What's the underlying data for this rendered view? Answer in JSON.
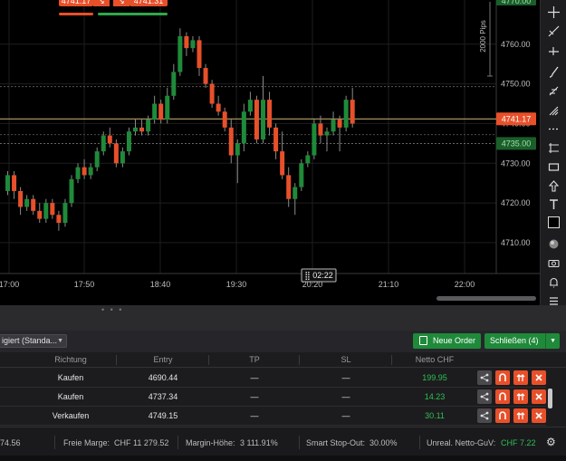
{
  "chart": {
    "time_labels": [
      "17:00",
      "17:50",
      "18:40",
      "19:30",
      "20:20",
      "21:10",
      "22:00"
    ],
    "price_labels": [
      "4760.00",
      "4750.00",
      "4740.00",
      "4730.00",
      "4720.00",
      "4710.00"
    ],
    "current_price_tag": "4741.17",
    "sl_price_tag": "4735.00",
    "top_price_tag": "4770.00",
    "pips_label": "2000 Pips",
    "time_cursor": "02:22",
    "sell_badge": "4741.17",
    "buy_badge": "4741.31",
    "colors": {
      "up": "#1f8a3a",
      "down": "#e8502a",
      "price_line": "#b9a16a",
      "grid": "#1e1e1e"
    }
  },
  "chart_data": {
    "type": "candlestick",
    "ylim": [
      4703,
      4768
    ],
    "x_ticks": [
      "17:00",
      "17:50",
      "18:40",
      "19:30",
      "20:20",
      "21:10",
      "22:00"
    ],
    "candles": [
      {
        "o": 4723,
        "c": 4727,
        "h": 4728,
        "l": 4722
      },
      {
        "o": 4727,
        "c": 4723,
        "h": 4728,
        "l": 4721
      },
      {
        "o": 4723,
        "c": 4719,
        "h": 4724,
        "l": 4717
      },
      {
        "o": 4719,
        "c": 4721,
        "h": 4722,
        "l": 4718
      },
      {
        "o": 4721,
        "c": 4718,
        "h": 4722,
        "l": 4717
      },
      {
        "o": 4718,
        "c": 4716,
        "h": 4720,
        "l": 4715
      },
      {
        "o": 4716,
        "c": 4720,
        "h": 4721,
        "l": 4715
      },
      {
        "o": 4720,
        "c": 4717,
        "h": 4721,
        "l": 4716
      },
      {
        "o": 4717,
        "c": 4715,
        "h": 4718,
        "l": 4713
      },
      {
        "o": 4715,
        "c": 4720,
        "h": 4721,
        "l": 4714
      },
      {
        "o": 4720,
        "c": 4726,
        "h": 4727,
        "l": 4719
      },
      {
        "o": 4726,
        "c": 4729,
        "h": 4730,
        "l": 4725
      },
      {
        "o": 4729,
        "c": 4727,
        "h": 4731,
        "l": 4726
      },
      {
        "o": 4727,
        "c": 4729,
        "h": 4730,
        "l": 4726
      },
      {
        "o": 4729,
        "c": 4733,
        "h": 4734,
        "l": 4728
      },
      {
        "o": 4733,
        "c": 4737,
        "h": 4738,
        "l": 4732
      },
      {
        "o": 4737,
        "c": 4735,
        "h": 4739,
        "l": 4734
      },
      {
        "o": 4735,
        "c": 4730,
        "h": 4736,
        "l": 4729
      },
      {
        "o": 4730,
        "c": 4733,
        "h": 4734,
        "l": 4729
      },
      {
        "o": 4733,
        "c": 4738,
        "h": 4739,
        "l": 4732
      },
      {
        "o": 4738,
        "c": 4739,
        "h": 4741,
        "l": 4737
      },
      {
        "o": 4739,
        "c": 4738,
        "h": 4741,
        "l": 4737
      },
      {
        "o": 4738,
        "c": 4741,
        "h": 4742,
        "l": 4737
      },
      {
        "o": 4741,
        "c": 4745,
        "h": 4747,
        "l": 4740
      },
      {
        "o": 4745,
        "c": 4741,
        "h": 4746,
        "l": 4740
      },
      {
        "o": 4741,
        "c": 4747,
        "h": 4749,
        "l": 4740
      },
      {
        "o": 4747,
        "c": 4753,
        "h": 4755,
        "l": 4746
      },
      {
        "o": 4753,
        "c": 4762,
        "h": 4764,
        "l": 4752
      },
      {
        "o": 4762,
        "c": 4759,
        "h": 4763,
        "l": 4757
      },
      {
        "o": 4759,
        "c": 4761,
        "h": 4762,
        "l": 4758
      },
      {
        "o": 4761,
        "c": 4754,
        "h": 4762,
        "l": 4752
      },
      {
        "o": 4754,
        "c": 4750,
        "h": 4755,
        "l": 4749
      },
      {
        "o": 4750,
        "c": 4745,
        "h": 4751,
        "l": 4744
      },
      {
        "o": 4745,
        "c": 4743,
        "h": 4747,
        "l": 4742
      },
      {
        "o": 4743,
        "c": 4739,
        "h": 4744,
        "l": 4738
      },
      {
        "o": 4739,
        "c": 4732,
        "h": 4741,
        "l": 4730
      },
      {
        "o": 4732,
        "c": 4735,
        "h": 4736,
        "l": 4725
      },
      {
        "o": 4735,
        "c": 4743,
        "h": 4745,
        "l": 4733
      },
      {
        "o": 4743,
        "c": 4746,
        "h": 4748,
        "l": 4742
      },
      {
        "o": 4746,
        "c": 4736,
        "h": 4747,
        "l": 4735
      },
      {
        "o": 4736,
        "c": 4746,
        "h": 4752,
        "l": 4735
      },
      {
        "o": 4746,
        "c": 4739,
        "h": 4748,
        "l": 4737
      },
      {
        "o": 4739,
        "c": 4733,
        "h": 4740,
        "l": 4731
      },
      {
        "o": 4733,
        "c": 4727,
        "h": 4738,
        "l": 4726
      },
      {
        "o": 4727,
        "c": 4721,
        "h": 4729,
        "l": 4719
      },
      {
        "o": 4721,
        "c": 4724,
        "h": 4725,
        "l": 4717
      },
      {
        "o": 4724,
        "c": 4730,
        "h": 4731,
        "l": 4723
      },
      {
        "o": 4730,
        "c": 4732,
        "h": 4733,
        "l": 4729
      },
      {
        "o": 4732,
        "c": 4740,
        "h": 4741,
        "l": 4731
      },
      {
        "o": 4740,
        "c": 4737,
        "h": 4742,
        "l": 4735
      },
      {
        "o": 4737,
        "c": 4738,
        "h": 4739,
        "l": 4733
      },
      {
        "o": 4738,
        "c": 4741,
        "h": 4743,
        "l": 4737
      },
      {
        "o": 4741,
        "c": 4739,
        "h": 4742,
        "l": 4733
      },
      {
        "o": 4739,
        "c": 4746,
        "h": 4747,
        "l": 4738
      },
      {
        "o": 4746,
        "c": 4740,
        "h": 4749,
        "l": 4739
      }
    ],
    "reference_lines": [
      4741.17,
      4735.0,
      4749.3,
      4737.2
    ]
  },
  "toolbar": {
    "icons": [
      "crosshair-icon",
      "trendline-icon",
      "horizontal-line-icon",
      "brush-icon",
      "fibonacci-icon",
      "pitchfork-icon",
      "dashed-line-icon",
      "channel-icon",
      "rectangle-icon",
      "arrow-icon",
      "text-icon",
      "color-swatch-icon",
      "sphere-icon",
      "camera-icon",
      "bell-icon",
      "list-icon"
    ]
  },
  "orders_bar": {
    "strategy_label": "igiert (Standa...",
    "new_order_label": "Neue Order",
    "close_label": "Schließen (4)"
  },
  "positions": {
    "headers": [
      "Richtung",
      "Entry",
      "TP",
      "SL",
      "Netto CHF"
    ],
    "rows": [
      {
        "direction": "Kaufen",
        "entry": "4690.44",
        "tp": "—",
        "sl": "—",
        "net": "199.95"
      },
      {
        "direction": "Kaufen",
        "entry": "4737.34",
        "tp": "—",
        "sl": "—",
        "net": "14.23"
      },
      {
        "direction": "Verkaufen",
        "entry": "4749.15",
        "tp": "—",
        "sl": "—",
        "net": "30.11"
      }
    ]
  },
  "status": {
    "balance_partial": "74.56",
    "free_margin_label": "Freie Marge:",
    "free_margin_value": "CHF 11 279.52",
    "margin_level_label": "Margin-Höhe:",
    "margin_level_value": "3 111.91%",
    "stop_out_label": "Smart Stop-Out:",
    "stop_out_value": "30.00%",
    "unreal_label": "Unreal. Netto-GuV:",
    "unreal_value": "CHF 7.22"
  }
}
